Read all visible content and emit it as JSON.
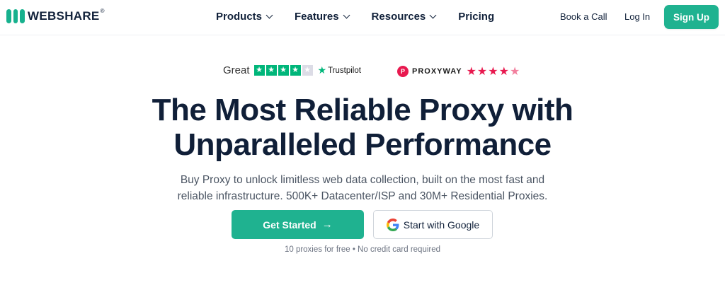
{
  "nav": {
    "brand": "WEBSHARE",
    "brand_mark": "®",
    "menu": [
      {
        "label": "Products",
        "has_dropdown": true
      },
      {
        "label": "Features",
        "has_dropdown": true
      },
      {
        "label": "Resources",
        "has_dropdown": true
      },
      {
        "label": "Pricing",
        "has_dropdown": false
      }
    ],
    "book_call": "Book a Call",
    "login": "Log In",
    "signup": "Sign Up"
  },
  "ratings": {
    "trustpilot": {
      "label": "Great",
      "stars_filled": 4,
      "stars_total": 5,
      "brand": "Trustpilot"
    },
    "proxyway": {
      "brand": "PROXYWAY",
      "rating": 4.5,
      "stars_total": 5
    }
  },
  "hero": {
    "title_line1": "The Most Reliable Proxy with",
    "title_line2": "Unparalleled Performance",
    "subtitle_line1": "Buy Proxy to unlock limitless web data collection, built on the most fast and",
    "subtitle_line2": "reliable infrastructure. 500K+ Datacenter/ISP and 30M+ Residential Proxies.",
    "cta_primary": "Get Started",
    "cta_google": "Start with Google",
    "note": "10 proxies for free • No credit card required"
  },
  "colors": {
    "accent": "#1fb290",
    "trustpilot_green": "#00b67a",
    "proxyway_pink": "#e8194f",
    "heading": "#101f38"
  }
}
